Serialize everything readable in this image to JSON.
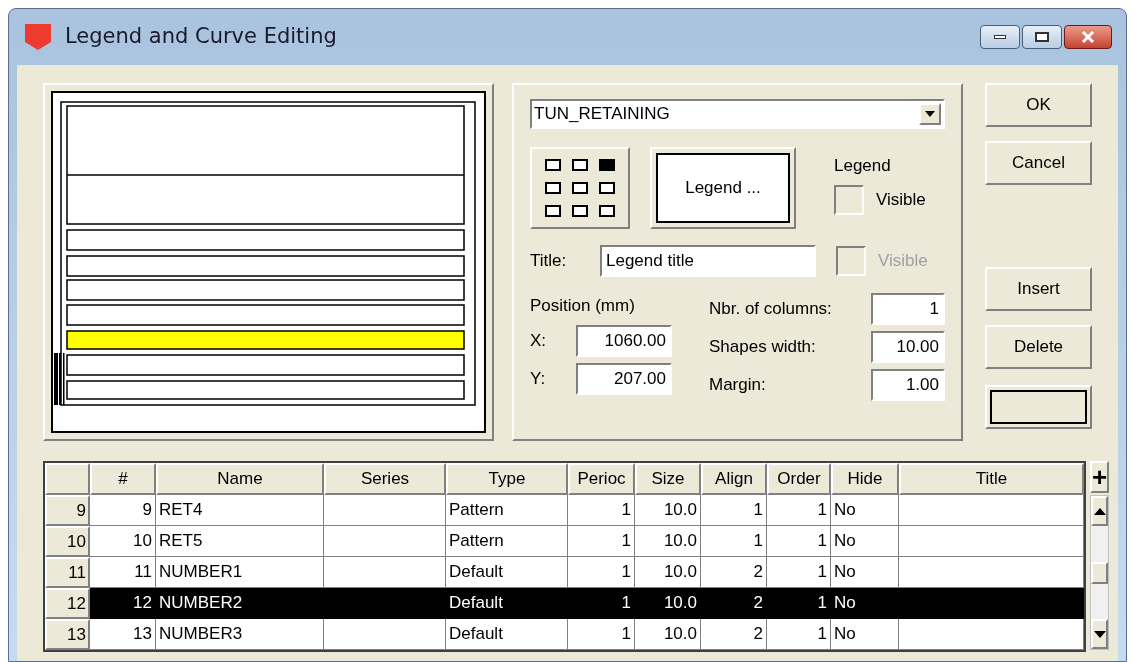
{
  "window": {
    "title": "Legend and Curve Editing"
  },
  "curve_select": {
    "value": "TUN_RETAINING"
  },
  "position_grid": [
    {
      "selected": false
    },
    {
      "selected": false
    },
    {
      "selected": true
    },
    {
      "selected": false
    },
    {
      "selected": false
    },
    {
      "selected": false
    },
    {
      "selected": false
    },
    {
      "selected": false
    },
    {
      "selected": false
    }
  ],
  "legend_button": "Legend ...",
  "legend_group": {
    "label": "Legend",
    "visible": {
      "label": "Visible",
      "checked": false,
      "disabled": false
    }
  },
  "title_field": {
    "label": "Title:",
    "value": "Legend title",
    "visible": {
      "label": "Visible",
      "checked": false,
      "disabled": true
    }
  },
  "position": {
    "label": "Position (mm)",
    "x": {
      "label": "X:",
      "value": "1060.00"
    },
    "y": {
      "label": "Y:",
      "value": "207.00"
    }
  },
  "settings": [
    {
      "label": "Nbr. of columns:",
      "value": "1"
    },
    {
      "label": "Shapes width:",
      "value": "10.00"
    },
    {
      "label": "Margin:",
      "value": "1.00"
    }
  ],
  "buttons": [
    {
      "label": "OK",
      "kind": "text"
    },
    {
      "label": "Cancel",
      "kind": "text"
    },
    {
      "label": "Insert",
      "kind": "text"
    },
    {
      "label": "Delete",
      "kind": "text"
    },
    {
      "kind": "swatch"
    }
  ],
  "table": {
    "columns": [
      "#",
      "Name",
      "Series",
      "Type",
      "Perioc",
      "Size",
      "Align",
      "Order",
      "Hide",
      "Title"
    ],
    "add_button": "+",
    "rows": [
      {
        "header": "9",
        "cells": [
          "9",
          "RET4",
          "",
          "Pattern",
          "1",
          "10.0",
          "1",
          "1",
          "No",
          ""
        ],
        "selected": false
      },
      {
        "header": "10",
        "cells": [
          "10",
          "RET5",
          "",
          "Pattern",
          "1",
          "10.0",
          "1",
          "1",
          "No",
          ""
        ],
        "selected": false
      },
      {
        "header": "11",
        "cells": [
          "11",
          "NUMBER1",
          "",
          "Default",
          "1",
          "10.0",
          "2",
          "1",
          "No",
          ""
        ],
        "selected": false
      },
      {
        "header": "12",
        "cells": [
          "12",
          "NUMBER2",
          "",
          "Default",
          "1",
          "10.0",
          "2",
          "1",
          "No",
          ""
        ],
        "selected": true
      },
      {
        "header": "13",
        "cells": [
          "13",
          "NUMBER3",
          "",
          "Default",
          "1",
          "10.0",
          "2",
          "1",
          "No",
          ""
        ],
        "selected": false
      }
    ]
  }
}
